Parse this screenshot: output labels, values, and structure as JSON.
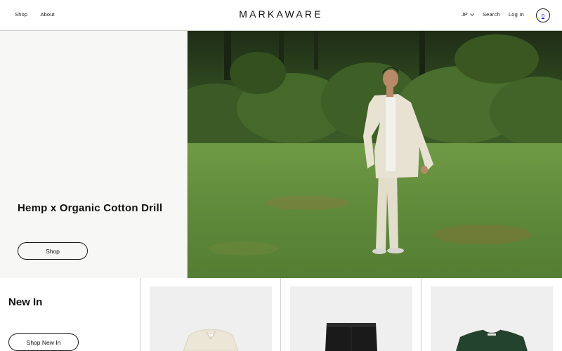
{
  "header": {
    "nav_left": [
      "Shop",
      "About"
    ],
    "brand": "MARKAWARE",
    "language": "JP",
    "search_label": "Search",
    "login_label": "Log In",
    "cart_count": "0"
  },
  "hero": {
    "title": "Hemp x Organic Cotton Drill",
    "button_label": "Shop"
  },
  "new_in": {
    "title": "New In",
    "button_label": "Shop New In",
    "products": [
      {
        "kind": "cream-jacket"
      },
      {
        "kind": "black-trousers"
      },
      {
        "kind": "green-tshirt"
      }
    ]
  },
  "colors": {
    "panel_bg": "#f7f7f5",
    "border": "#cfcfcf",
    "text": "#1a1a1a",
    "product_bg": "#efefef"
  }
}
